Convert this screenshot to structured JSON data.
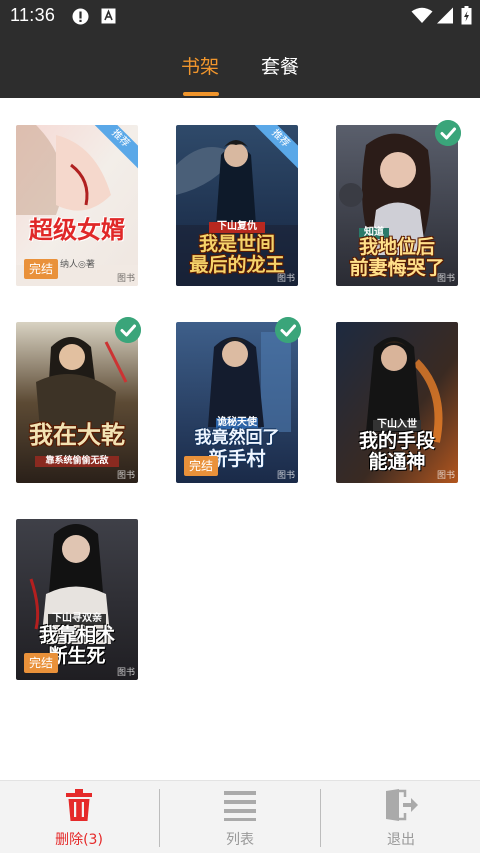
{
  "status_bar": {
    "time": "11:36"
  },
  "tabs": [
    {
      "label": "书架",
      "active": true
    },
    {
      "label": "套餐",
      "active": false
    }
  ],
  "colors": {
    "accent": "#f0952c",
    "check": "#3aa57a",
    "delete_red": "#e52a2a",
    "header_bg": "#2d2d2d"
  },
  "books": [
    {
      "title_lines": [
        "超级女婿"
      ],
      "author": "纳人◎著",
      "finished_badge": "完结",
      "recommend_tag": "推荐",
      "watermark": "图书",
      "selected": false
    },
    {
      "subtitle": "下山复仇",
      "title_lines": [
        "我是世间",
        "最后的龙王"
      ],
      "recommend_tag": "推荐",
      "watermark": "图书",
      "selected": false
    },
    {
      "subtitle": "知道",
      "title_lines": [
        "我地位后",
        "前妻悔哭了"
      ],
      "watermark": "图书",
      "selected": true
    },
    {
      "title_lines": [
        "我在大乾"
      ],
      "tagline": "靠系统偷偷无敌",
      "watermark": "图书",
      "selected": true
    },
    {
      "subtitle": "诡秘天使",
      "title_lines": [
        "我竟然回了",
        "新手村"
      ],
      "finished_badge": "完结",
      "watermark": "图书",
      "selected": true
    },
    {
      "subtitle": "下山入世",
      "title_lines": [
        "我的手段",
        "能通神"
      ],
      "watermark": "图书",
      "selected": false
    },
    {
      "subtitle": "下山寻双亲",
      "title_lines": [
        "我靠相术",
        "断生死"
      ],
      "finished_badge": "完结",
      "watermark": "图书",
      "selected": false
    }
  ],
  "bottom_bar": {
    "delete_label": "删除(3)",
    "list_label": "列表",
    "exit_label": "退出"
  }
}
